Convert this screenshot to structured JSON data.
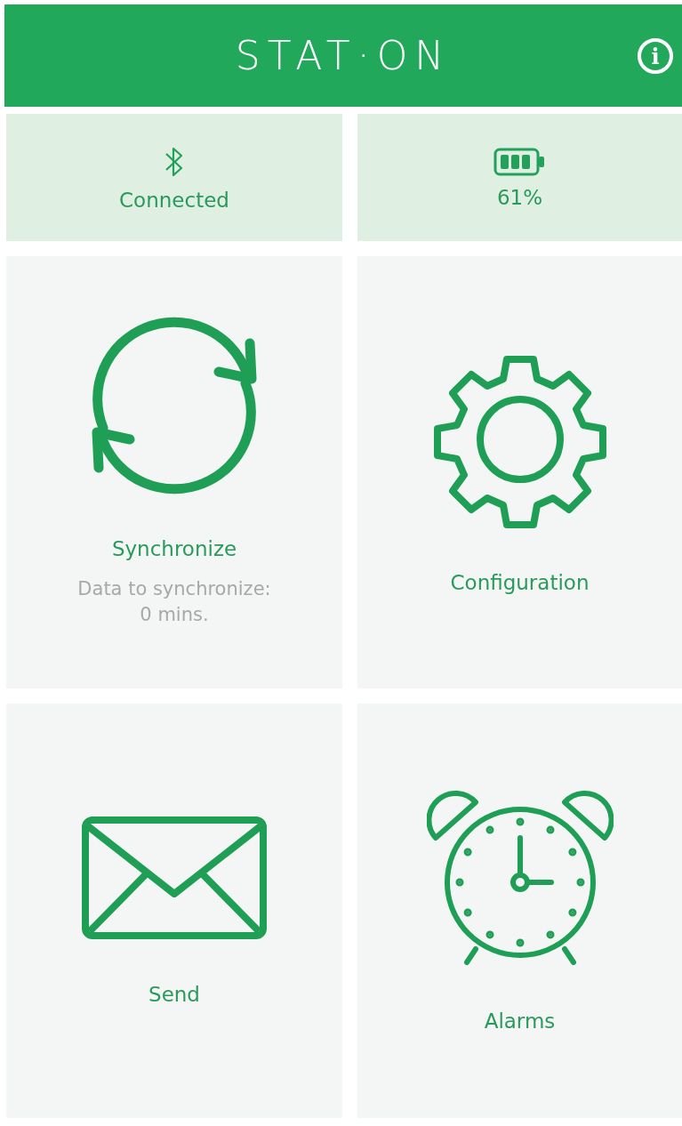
{
  "header": {
    "logo": "STAT·ON",
    "info_icon": "i"
  },
  "status": [
    {
      "kind": "bluetooth",
      "label": "Connected"
    },
    {
      "kind": "battery",
      "label": "61%"
    }
  ],
  "tiles": [
    {
      "kind": "sync",
      "label": "Synchronize",
      "detail_lines": [
        "Data to synchronize:",
        "0 mins."
      ]
    },
    {
      "kind": "gear",
      "label": "Configuration"
    },
    {
      "kind": "mail",
      "label": "Send"
    },
    {
      "kind": "alarm",
      "label": "Alarms"
    }
  ]
}
